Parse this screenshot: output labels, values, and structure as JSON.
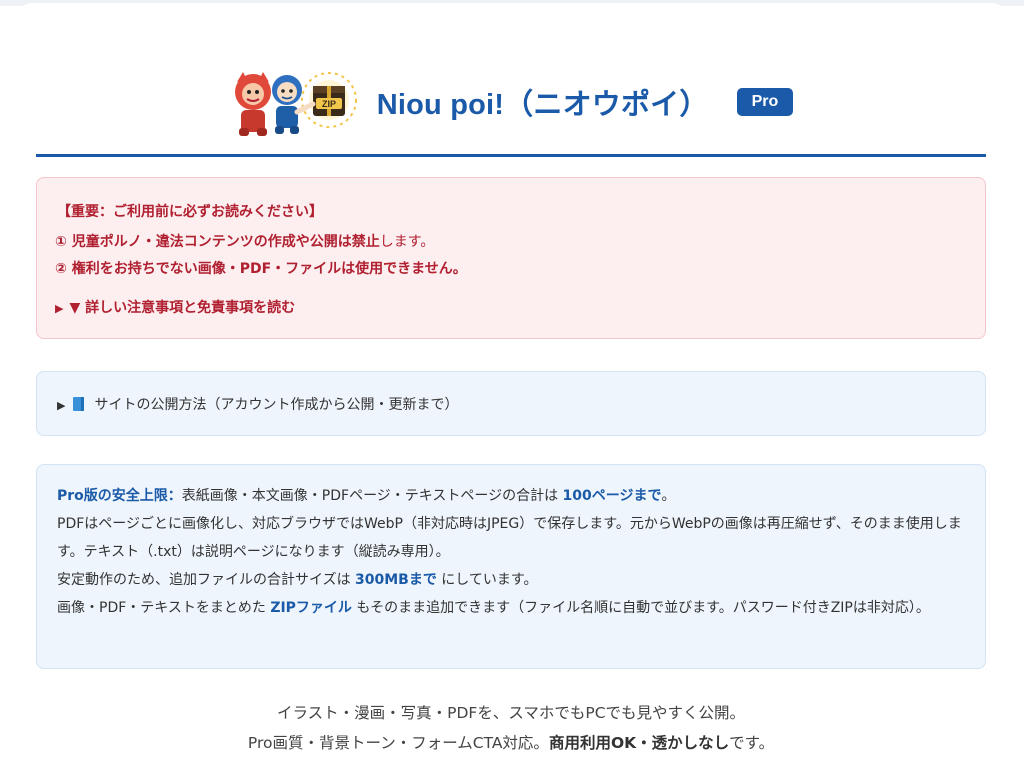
{
  "header": {
    "logo_icon": "mascot-zip-logo-icon",
    "title": "Niou poi!（ニオウポイ）",
    "badge": "Pro",
    "accent_color": "#1b5aa8"
  },
  "warning": {
    "heading": "【重要：ご利用前に必ずお読みください】",
    "item1_bold": "① 児童ポルノ・違法コンテンツの作成や公開は禁止",
    "item1_rest": "します。",
    "item2": "② 権利をお持ちでない画像・PDF・ファイルは使用できません。",
    "details_marker": "▶",
    "details_label": "▼ 詳しい注意事項と免責事項を読む",
    "color": "#b02030"
  },
  "guide": {
    "marker": "▶",
    "icon": "blue-book-icon",
    "label": "サイトの公開方法（アカウント作成から公開・更新まで）"
  },
  "info": {
    "p1_lead": "Pro版の安全上限：",
    "p1_text": "表紙画像・本文画像・PDFページ・テキストページの合計は ",
    "p1_limit": "100ページまで",
    "p1_end": "。",
    "p2": "PDFはページごとに画像化し、対応ブラウザではWebP（非対応時はJPEG）で保存します。元からWebPの画像は再圧縮せず、そのまま使用します。テキスト（.txt）は説明ページになります（縦読み専用）。",
    "p3_text": "安定動作のため、追加ファイルの合計サイズは ",
    "p3_limit": "300MBまで",
    "p3_end": " にしています。",
    "p4_text": "画像・PDF・テキストをまとめた ",
    "p4_zip": "ZIPファイル",
    "p4_end": " もそのまま追加できます（ファイル名順に自動で並びます。パスワード付きZIPは非対応）。"
  },
  "tagline": {
    "line1": "イラスト・漫画・写真・PDFを、スマホでもPCでも見やすく公開。",
    "line2_text": "Pro画質・背景トーン・フォームCTA対応。",
    "line2_bold": "商用利用OK・透かしなし",
    "line2_end": "です。"
  }
}
